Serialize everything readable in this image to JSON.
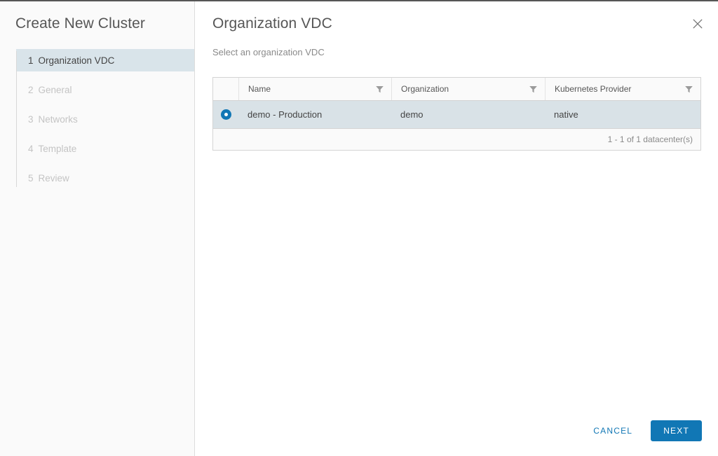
{
  "sidebar": {
    "title": "Create New Cluster",
    "steps": [
      {
        "num": "1",
        "label": "Organization VDC",
        "active": true
      },
      {
        "num": "2",
        "label": "General",
        "active": false
      },
      {
        "num": "3",
        "label": "Networks",
        "active": false
      },
      {
        "num": "4",
        "label": "Template",
        "active": false
      },
      {
        "num": "5",
        "label": "Review",
        "active": false
      }
    ]
  },
  "panel": {
    "title": "Organization VDC",
    "subtitle": "Select an organization VDC",
    "close_icon": "close-icon"
  },
  "grid": {
    "columns": [
      {
        "label": "Name",
        "filter_icon": "filter-icon"
      },
      {
        "label": "Organization",
        "filter_icon": "filter-icon"
      },
      {
        "label": "Kubernetes Provider",
        "filter_icon": "filter-icon"
      }
    ],
    "rows": [
      {
        "selected": true,
        "name": "demo - Production",
        "organization": "demo",
        "kubernetes_provider": "native"
      }
    ],
    "footer_text": "1 - 1 of 1 datacenter(s)"
  },
  "actions": {
    "cancel_label": "CANCEL",
    "next_label": "NEXT"
  },
  "colors": {
    "accent": "#1177b5",
    "selected_row": "#d9e2e7",
    "active_step": "#d9e4ea",
    "text": "#565656",
    "muted_text": "#8a8a8a",
    "disabled_step": "#c4c4c4"
  }
}
